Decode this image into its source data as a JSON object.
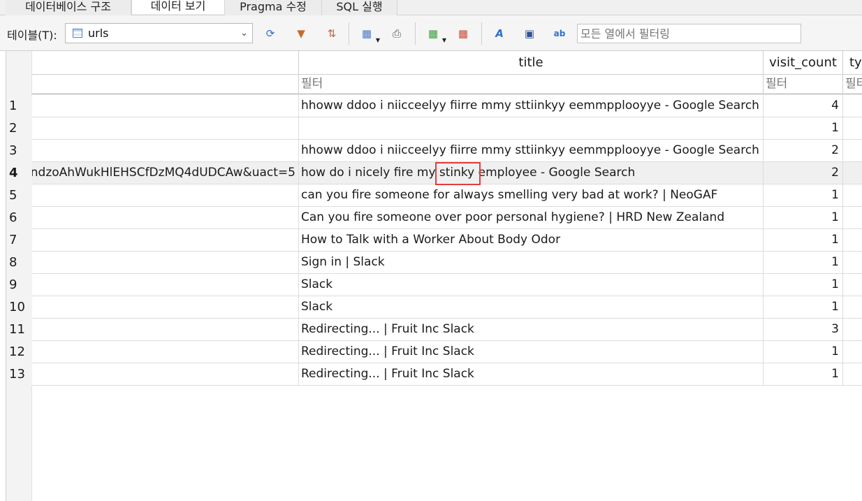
{
  "tabs": [
    {
      "label": "데이터베이스 구조",
      "active": false
    },
    {
      "label": "데이터 보기",
      "active": true
    },
    {
      "label": "Pragma 수정",
      "active": false
    },
    {
      "label": "SQL 실행",
      "active": false
    }
  ],
  "toolbar": {
    "table_label": "테이블(T):",
    "table_selected": "urls",
    "filter_placeholder": "모든 열에서 필터링",
    "icons": [
      "refresh-icon",
      "clear-filters-icon",
      "clear-sort-icon",
      "save-table-icon",
      "print-icon",
      "insert-record-icon",
      "delete-record-icon",
      "font-format-icon",
      "set-null-icon",
      "find-replace-icon"
    ]
  },
  "grid": {
    "columns": [
      {
        "key": "url",
        "header": ""
      },
      {
        "key": "title",
        "header": "title"
      },
      {
        "key": "visit_count",
        "header": "visit_count"
      },
      {
        "key": "typed_count",
        "header": "typ"
      }
    ],
    "filter_placeholder": "필터",
    "selected_row": 4,
    "rows": [
      {
        "num": "1",
        "url": "",
        "title": "hhoww ddoo i niicceelyy fiirre mmy sttiinkyy eemmpplooyye - Google Search",
        "visit_count": "4"
      },
      {
        "num": "2",
        "url": "",
        "title": "",
        "visit_count": "1"
      },
      {
        "num": "3",
        "url": "",
        "title": "hhoww ddoo i niicceelyy fiirre mmy sttiinkyy eemmpplooyye - Google Search",
        "visit_count": "2"
      },
      {
        "num": "4",
        "url": "ndzoAhWukHlEHSCfDzMQ4dUDCAw&uact=5",
        "title": "how do i nicely fire my stinky employee - Google Search",
        "visit_count": "2"
      },
      {
        "num": "5",
        "url": "",
        "title": "can you fire someone for always smelling very bad at work? | NeoGAF",
        "visit_count": "1"
      },
      {
        "num": "6",
        "url": "",
        "title": "Can you fire someone over poor personal hygiene? | HRD New Zealand",
        "visit_count": "1"
      },
      {
        "num": "7",
        "url": "",
        "title": "How to Talk with a Worker About Body Odor",
        "visit_count": "1"
      },
      {
        "num": "8",
        "url": "",
        "title": "Sign in | Slack",
        "visit_count": "1"
      },
      {
        "num": "9",
        "url": "",
        "title": "Slack",
        "visit_count": "1"
      },
      {
        "num": "10",
        "url": "",
        "title": "Slack",
        "visit_count": "1"
      },
      {
        "num": "11",
        "url": "",
        "title": "Redirecting... | Fruit Inc Slack",
        "visit_count": "3"
      },
      {
        "num": "12",
        "url": "",
        "title": "Redirecting... | Fruit Inc Slack",
        "visit_count": "1"
      },
      {
        "num": "13",
        "url": "",
        "title": "Redirecting... | Fruit Inc Slack",
        "visit_count": "1"
      }
    ]
  },
  "colors": {
    "highlight_border": "#e53c3c",
    "selected_row_bg": "#f0f0f0"
  }
}
